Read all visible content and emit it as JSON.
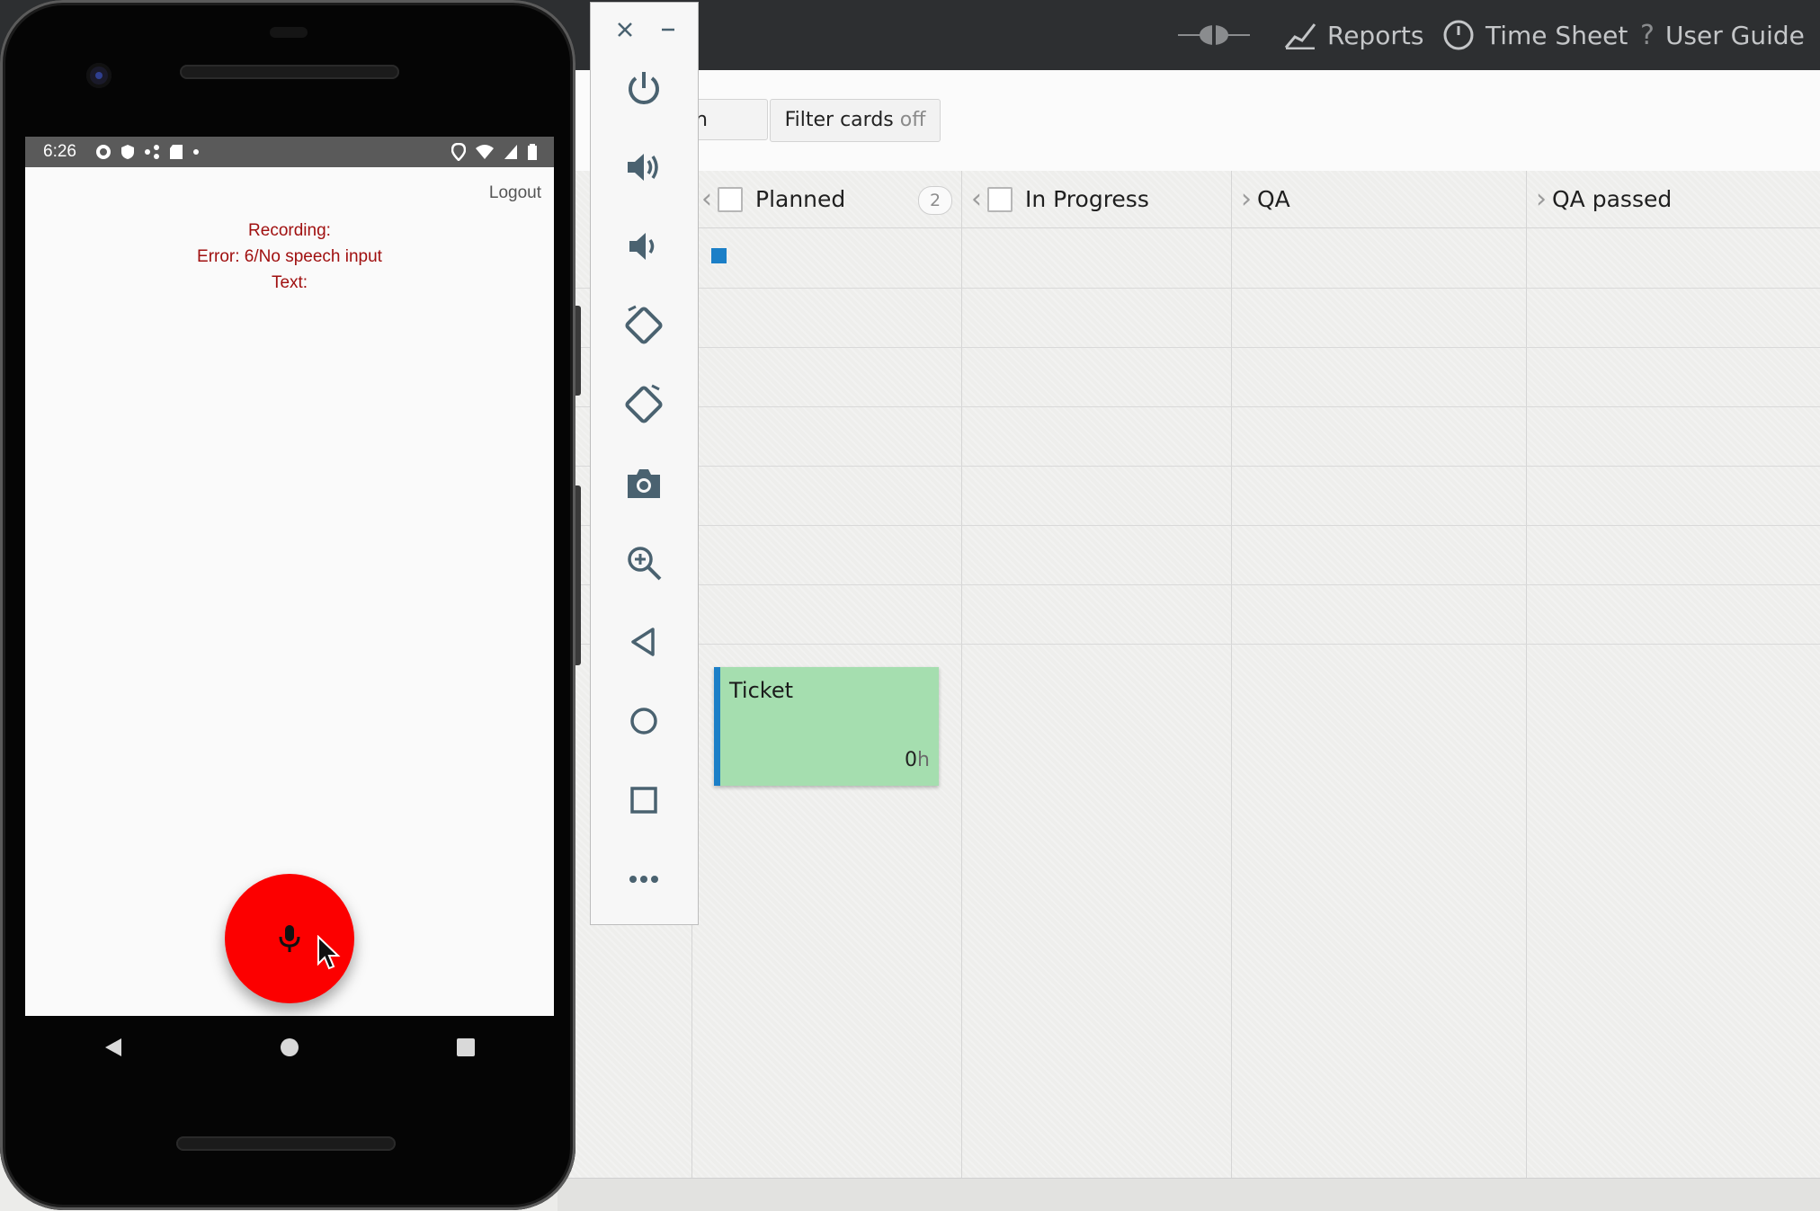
{
  "topnav": {
    "reports": "Reports",
    "timesheet": "Time Sheet",
    "userguide": "User Guide"
  },
  "toolbar": {
    "search_partial": "h",
    "filter_label": "Filter cards",
    "filter_state": "off"
  },
  "columns": [
    {
      "name": "Planned",
      "count": "2"
    },
    {
      "name": "In Progress"
    },
    {
      "name": "QA"
    },
    {
      "name": "QA passed"
    }
  ],
  "card": {
    "title": "Ticket",
    "hours_value": "0",
    "hours_unit": "h",
    "color": "#a5deaf",
    "accent": "#1b7fc7"
  },
  "emulator_toolbar": {
    "buttons": [
      "close-icon",
      "minimize-icon",
      "power-icon",
      "volume-up-icon",
      "volume-down-icon",
      "rotate-left-icon",
      "rotate-right-icon",
      "camera-icon",
      "zoom-icon",
      "back-icon",
      "home-icon",
      "overview-icon",
      "more-icon"
    ]
  },
  "phone": {
    "status_time": "6:26",
    "logout": "Logout",
    "recording": "Recording:",
    "error": "Error: 6/No speech input",
    "text": "Text:",
    "fab_color": "#fc0000"
  }
}
